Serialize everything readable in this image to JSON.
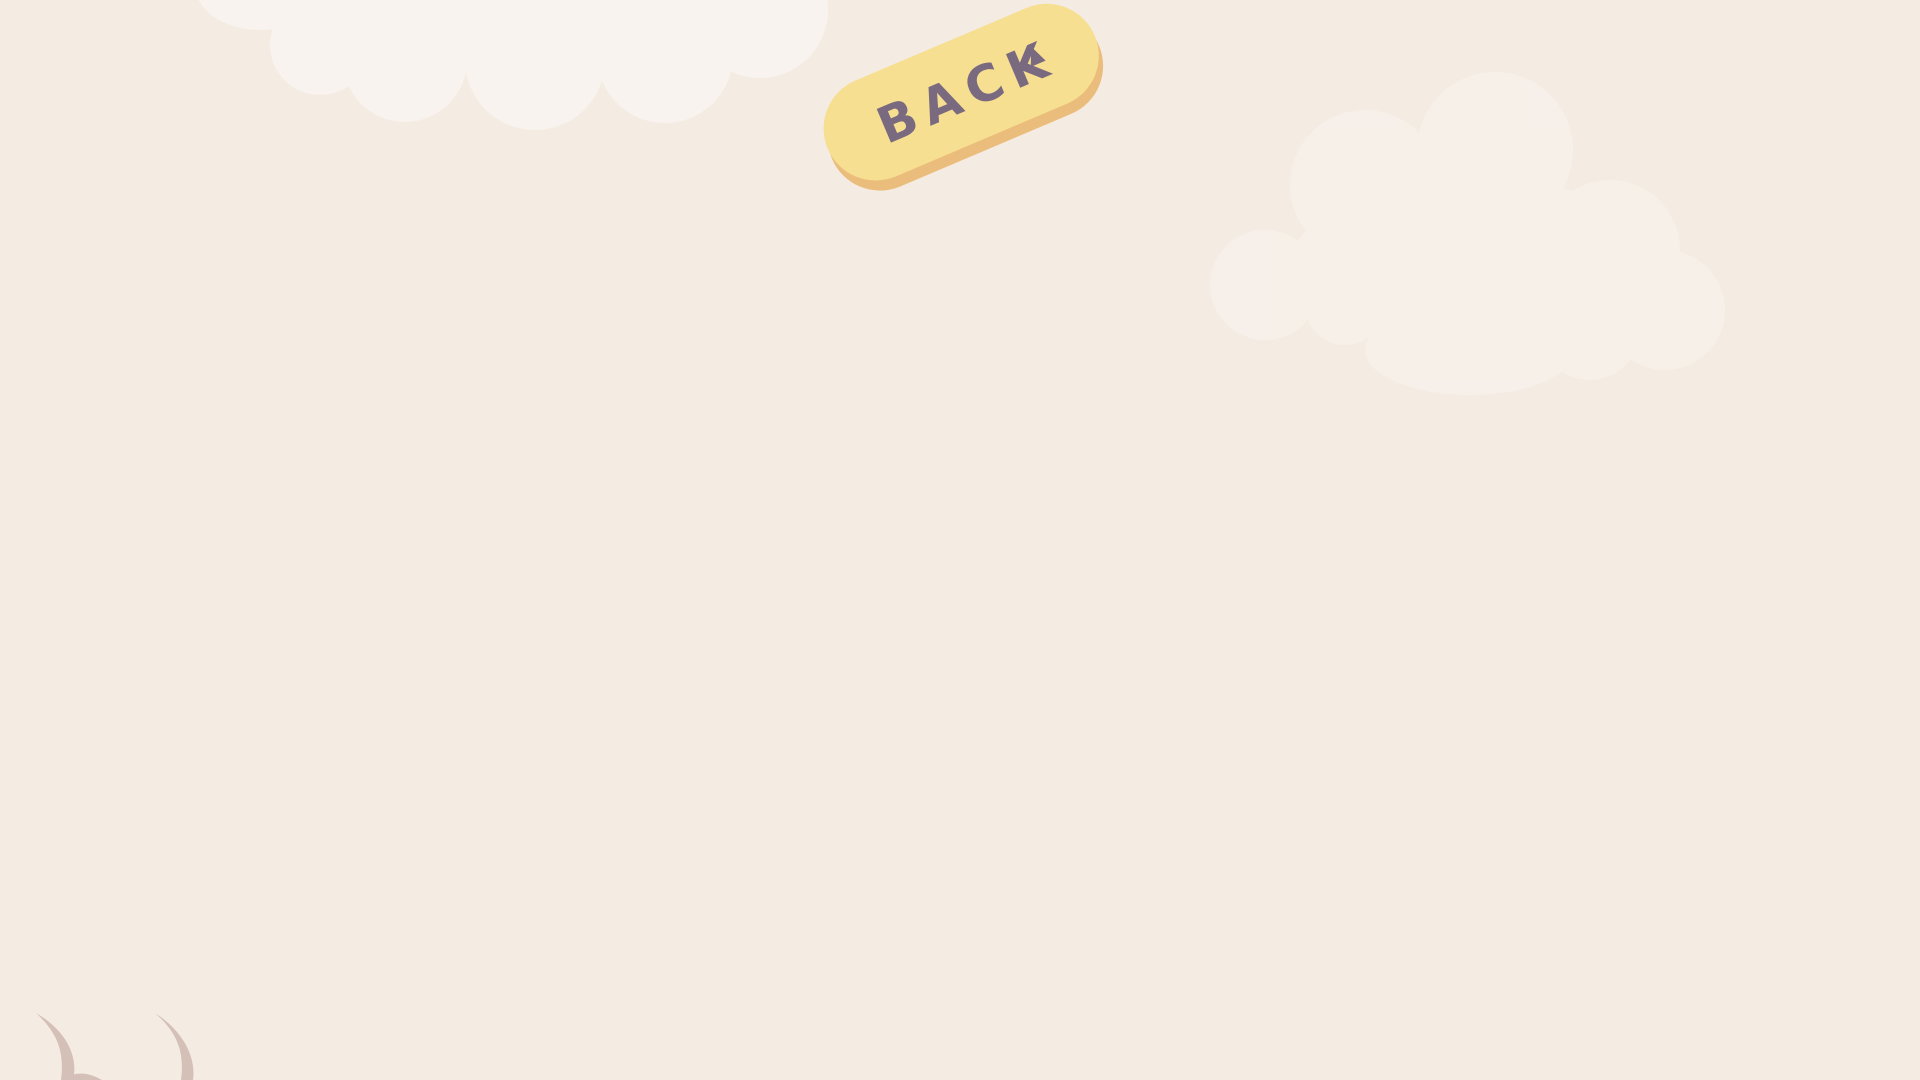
{
  "screen": {
    "background_color": "#f4ece3"
  },
  "back_button": {
    "label": "BACK",
    "icon": "play-triangle-icon",
    "face_color": "#f6df90",
    "shadow_color": "#ebbd7c",
    "text_color": "#7a6a80"
  },
  "clouds": {
    "color": "#f8f3ee"
  },
  "creature": {
    "parts": [
      "left-horn",
      "right-horn"
    ],
    "color": "#d5c0b8"
  }
}
